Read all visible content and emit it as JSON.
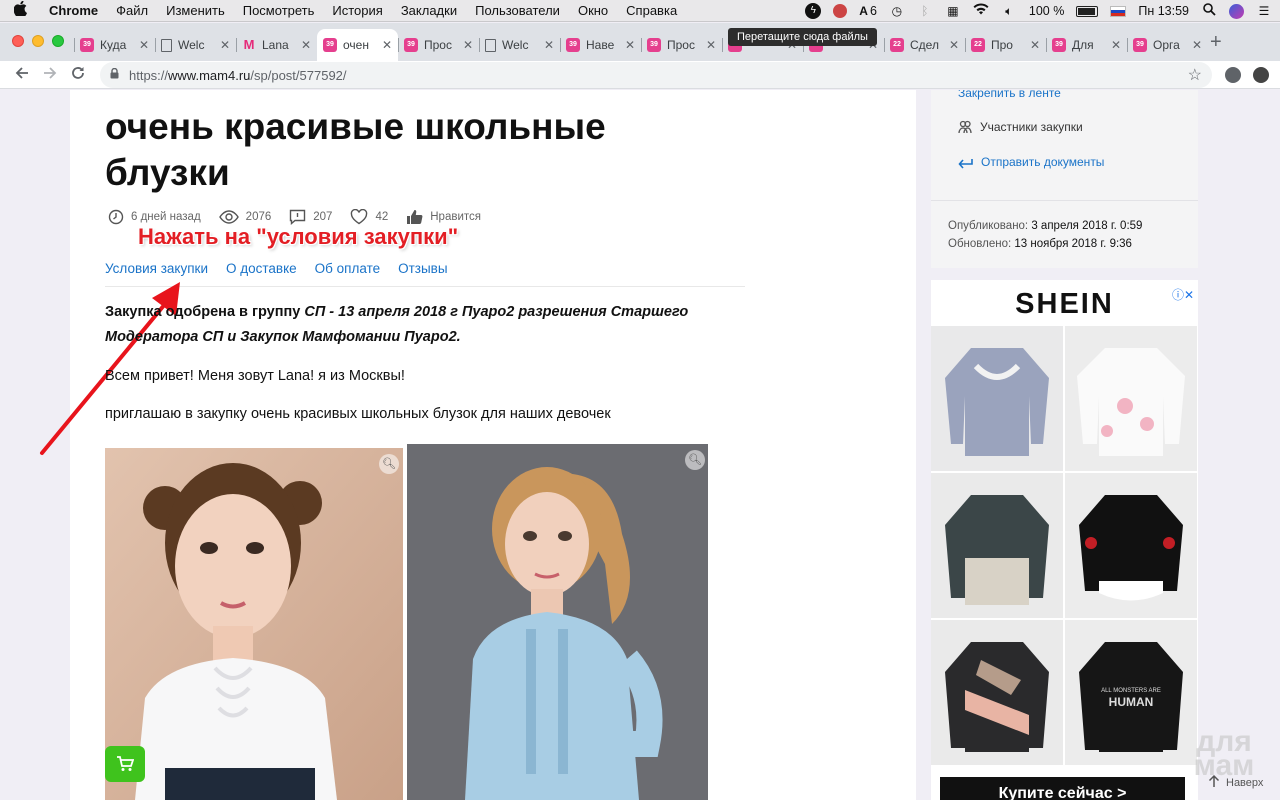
{
  "menubar": {
    "apple": "",
    "items": [
      "Chrome",
      "Файл",
      "Изменить",
      "Посмотреть",
      "История",
      "Закладки",
      "Пользователи",
      "Окно",
      "Справка"
    ],
    "adobe_count": "6",
    "battery": "100 %",
    "clock": "Пн 13:59"
  },
  "tooltip": "Перетащите сюда файлы",
  "tabs": [
    {
      "title": "Куда",
      "fav": "39"
    },
    {
      "title": "Welc",
      "fav": "doc"
    },
    {
      "title": "Lana",
      "fav": "M"
    },
    {
      "title": "очен",
      "fav": "39",
      "active": true
    },
    {
      "title": "Прос",
      "fav": "39"
    },
    {
      "title": "Welc",
      "fav": "doc"
    },
    {
      "title": "Наве",
      "fav": "39"
    },
    {
      "title": "Прос",
      "fav": "39"
    },
    {
      "title": "",
      "fav": "39"
    },
    {
      "title": "",
      "fav": "39"
    },
    {
      "title": "Сдел",
      "fav": "22"
    },
    {
      "title": "Про",
      "fav": "22"
    },
    {
      "title": "Для",
      "fav": "39"
    },
    {
      "title": "Орга",
      "fav": "39"
    }
  ],
  "address": {
    "scheme": "https://",
    "host": "www.mam4.ru",
    "path": "/sp/post/577592/"
  },
  "post": {
    "title": "очень красивые школьные блузки",
    "time": "6 дней назад",
    "views": "2076",
    "comments": "207",
    "likes": "42",
    "like_label": "Нравится",
    "annotation": "Нажать на \"условия закупки\"",
    "tabs": [
      "Условия закупки",
      "О доставке",
      "Об оплате",
      "Отзывы"
    ],
    "bold_intro": "Закупка одобрена в группу СП - 13 апреля 2018 г Пуаро2 разрешения Старшего Модератора СП и Закупок Мамфомании Пуаро2.",
    "bold_intro_prefix": "Закупка одобрена в группу ",
    "bold_intro_italic": "СП - 13 апреля 2018 г Пуаро2 разрешения Старшего Модератора СП и Закупок Мамфомании Пуаро2.",
    "greeting": "Всем привет! Меня зовут Lana! я из Москвы!",
    "invite": "приглашаю в закупку очень красивых школьных блузок для наших девочек"
  },
  "sidebar": {
    "pin": "Закрепить в ленте",
    "members": "Участники закупки",
    "send_docs": "Отправить документы",
    "published_label": "Опубликовано:",
    "published_value": "3 апреля 2018 г. 0:59",
    "updated_label": "Обновлено:",
    "updated_value": "13 ноября 2018 г. 9:36"
  },
  "ad": {
    "brand": "SHEIN",
    "button": "Купите сейчас >"
  },
  "watermark": "для мам",
  "scroll_top": "Наверх",
  "colors": {
    "link": "#1a73c8",
    "annotation": "#e31e24",
    "cart": "#3fc31d"
  }
}
